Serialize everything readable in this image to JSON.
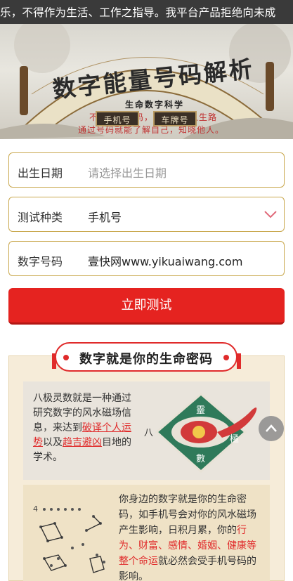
{
  "marquee": {
    "text": "乐，不得作为生活、工作之指导。我平台产品拒绝向未成"
  },
  "banner": {
    "title": "数字能量号码解析",
    "subtitle": "生命数字科学",
    "line1": "不同数字号码，通向不同人生路",
    "line2": "通过号码就能了解自己，知晓他人。",
    "tab_phone": "手机号",
    "tab_plate": "车牌号"
  },
  "form": {
    "birth_label": "出生日期",
    "birth_placeholder": "请选择出生日期",
    "type_label": "测试种类",
    "type_value": "手机号",
    "number_label": "数字号码",
    "number_value": "壹快网www.yikuaiwang.com",
    "submit_label": "立即测试"
  },
  "section": {
    "title": "数字就是你的生命密码",
    "p1_a": "八极灵数就是一种通过研究数字的风水磁场信息，来达到",
    "p1_link1": "破译个人运势",
    "p1_b": "以及",
    "p1_link2": "趋吉避凶",
    "p1_c": "目地的学术。",
    "logo_top": "靈",
    "logo_left": "八",
    "logo_right": "極",
    "logo_bottom": "數",
    "p2_a": "你身边的数字就是你的生命密码，如手机号会对你的风水磁场产生影响，日积月累，你的",
    "p2_red": "行为、财富、感情、婚姻、健康等整个命运",
    "p2_b": "就必然会受手机号码的影响。",
    "p2_num": "4"
  },
  "colors": {
    "accent": "#e52320",
    "gold_border": "#c9a84e",
    "card_bg": "#f6ecd9"
  }
}
